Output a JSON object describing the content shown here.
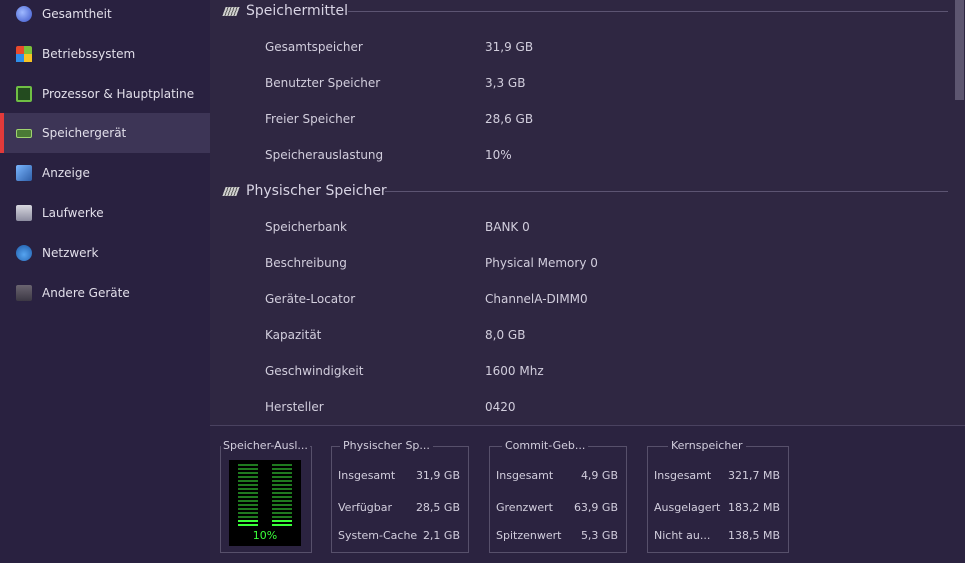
{
  "sidebar": {
    "items": [
      {
        "label": "Gesamtheit",
        "icon": "globe-icon"
      },
      {
        "label": "Betriebssystem",
        "icon": "windows-icon"
      },
      {
        "label": "Prozessor & Hauptplatine",
        "icon": "cpu-icon"
      },
      {
        "label": "Speichergerät",
        "icon": "memory-icon",
        "active": true
      },
      {
        "label": "Anzeige",
        "icon": "display-icon"
      },
      {
        "label": "Laufwerke",
        "icon": "drive-icon"
      },
      {
        "label": "Netzwerk",
        "icon": "network-icon"
      },
      {
        "label": "Andere Geräte",
        "icon": "device-icon"
      }
    ],
    "active_color": "#e23a3a"
  },
  "speichermittel": {
    "title": "Speichermittel",
    "rows": [
      {
        "label": "Gesamtspeicher",
        "value": "31,9 GB"
      },
      {
        "label": "Benutzter Speicher",
        "value": "3,3 GB"
      },
      {
        "label": "Freier Speicher",
        "value": "28,6 GB"
      },
      {
        "label": "Speicherauslastung",
        "value": "10%"
      }
    ]
  },
  "physischer_speicher": {
    "title": "Physischer Speicher",
    "rows": [
      {
        "label": "Speicherbank",
        "value": "BANK 0"
      },
      {
        "label": "Beschreibung",
        "value": "Physical Memory 0"
      },
      {
        "label": "Geräte-Locator",
        "value": "ChannelA-DIMM0"
      },
      {
        "label": "Kapazität",
        "value": "8,0 GB"
      },
      {
        "label": "Geschwindigkeit",
        "value": "1600 Mhz"
      },
      {
        "label": "Hersteller",
        "value": "0420"
      }
    ]
  },
  "bottom": {
    "gauge": {
      "title": "Speicher-Ausl...",
      "percent_label": "10%",
      "level": 0.1
    },
    "groups": [
      {
        "title": "Physischer Sp...",
        "rows": [
          {
            "label": "Insgesamt",
            "value": "31,9 GB"
          },
          {
            "label": "Verfügbar",
            "value": "28,5 GB"
          },
          {
            "label": "System-Cache",
            "value": "2,1 GB"
          }
        ]
      },
      {
        "title": "Commit-Geb...",
        "rows": [
          {
            "label": "Insgesamt",
            "value": "4,9 GB"
          },
          {
            "label": "Grenzwert",
            "value": "63,9 GB"
          },
          {
            "label": "Spitzenwert",
            "value": "5,3 GB"
          }
        ]
      },
      {
        "title": "Kernspeicher",
        "rows": [
          {
            "label": "Insgesamt",
            "value": "321,7 MB"
          },
          {
            "label": "Ausgelagert",
            "value": "183,2 MB"
          },
          {
            "label": "Nicht au...",
            "value": "138,5 MB"
          }
        ]
      }
    ]
  }
}
